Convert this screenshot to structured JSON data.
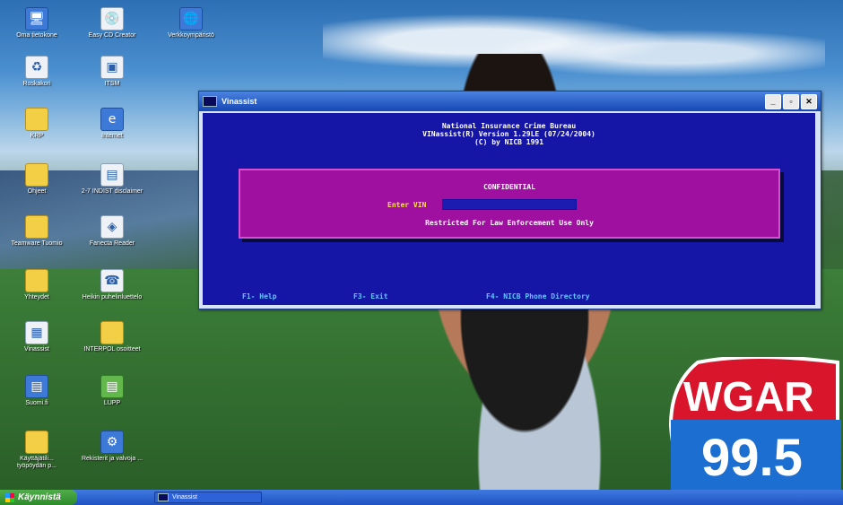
{
  "desktop": {
    "icons": [
      {
        "label": "Oma tietokone",
        "glyph": "🖥",
        "kind": "sysico"
      },
      {
        "label": "Easy CD Creator",
        "glyph": "💿",
        "kind": "doc"
      },
      {
        "label": "Verkkoympäristö",
        "glyph": "🌐",
        "kind": "sysico"
      },
      {
        "label": "Roskakori",
        "glyph": "♻",
        "kind": "doc"
      },
      {
        "label": "ITSM",
        "glyph": "▣",
        "kind": "doc"
      },
      {
        "label": "KRP",
        "glyph": "",
        "kind": "folder"
      },
      {
        "label": "Internet",
        "glyph": "e",
        "kind": "sysico"
      },
      {
        "label": "Ohjeet",
        "glyph": "",
        "kind": "folder"
      },
      {
        "label": "2-7 INDIST disclaimer",
        "glyph": "▤",
        "kind": "doc"
      },
      {
        "label": "Teamware Tuomio",
        "glyph": "",
        "kind": "folder"
      },
      {
        "label": "Fanecta Reader",
        "glyph": "◈",
        "kind": "doc"
      },
      {
        "label": "Yhteydet",
        "glyph": "",
        "kind": "folder"
      },
      {
        "label": "Heikin puhelinluettelo",
        "glyph": "☎",
        "kind": "doc"
      },
      {
        "label": "Vinassist",
        "glyph": "▦",
        "kind": "doc"
      },
      {
        "label": "INTERPOL osoitteet",
        "glyph": "",
        "kind": "folder"
      },
      {
        "label": "Suomi.fi",
        "glyph": "▤",
        "kind": "sysico"
      },
      {
        "label": "LUPP",
        "glyph": "▤",
        "kind": "green"
      },
      {
        "label": "Käyttäjätili... työpöydän p...",
        "glyph": "",
        "kind": "folder"
      },
      {
        "label": "Rekisterit ja valvoja ...",
        "glyph": "⚙",
        "kind": "sysico"
      }
    ],
    "logo": {
      "line1": "WGAR",
      "line2": "99.5"
    }
  },
  "window": {
    "title": "Vinassist",
    "buttons": {
      "minimize": "_",
      "maximize": "▫",
      "close": "✕"
    },
    "header": [
      "National Insurance Crime Bureau",
      "VINassist(R) Version 1.29LE (07/24/2004)",
      "(C) by NICB 1991"
    ],
    "panel": {
      "title": "CONFIDENTIAL",
      "vin_label": "Enter VIN",
      "vin_value": "",
      "notice": "Restricted For Law Enforcement Use Only"
    },
    "fkeys": [
      "F1- Help",
      "F3- Exit",
      "F4- NICB Phone Directory"
    ]
  },
  "taskbar": {
    "start_label": "Käynnistä",
    "task_label": "Vinassist"
  }
}
